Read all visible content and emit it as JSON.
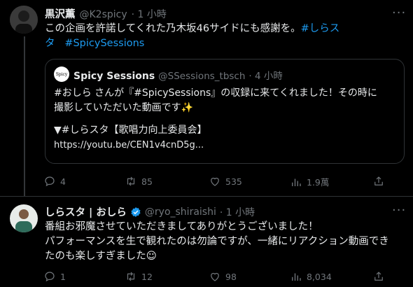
{
  "tweet1": {
    "author_name": "黒沢薫",
    "handle": "@K2spicy",
    "time": "· 1 小時",
    "text_line1": "この企画を許諾してくれた乃木坂46サイドにも感謝を。",
    "hashtag_a_line1": "#しらス",
    "hashtag_a_line2": "タ",
    "hashtag_b": "#SpicySessions",
    "more": "···",
    "quote": {
      "logo_text": "Spicy",
      "author_name": "Spicy Sessions",
      "handle": "@SSessions_tbsch",
      "time": "· 4 小時",
      "line1": "#おしら さんが『#SpicySessions』の収録に来てくれました！その時に",
      "line2": "撮影していただいた動画です✨",
      "line3": "▼#しらスタ【歌唱力向上委員会】",
      "line4": "https://youtu.be/CEN1v4cnD5g..."
    },
    "actions": {
      "replies": "4",
      "retweets": "85",
      "likes": "535",
      "views": "1.9萬"
    }
  },
  "tweet2": {
    "author_name": "しらスタ | おしら",
    "handle": "@ryo_shiraishi",
    "time": "· 1 小時",
    "line1": "番組お邪魔させていただきましてありがとうございました！",
    "line2": "パフォーマンスを生で観れたのは勿論ですが、一緒にリアクション動画でき",
    "line3": "たのも楽しすぎました☺",
    "more": "···",
    "actions": {
      "replies": "1",
      "retweets": "12",
      "likes": "98",
      "views": "8,034"
    }
  },
  "colors": {
    "background": "#000000",
    "text": "#e7e9ea",
    "muted": "#71767b",
    "link": "#1d9bf0",
    "border": "#2f3336"
  }
}
